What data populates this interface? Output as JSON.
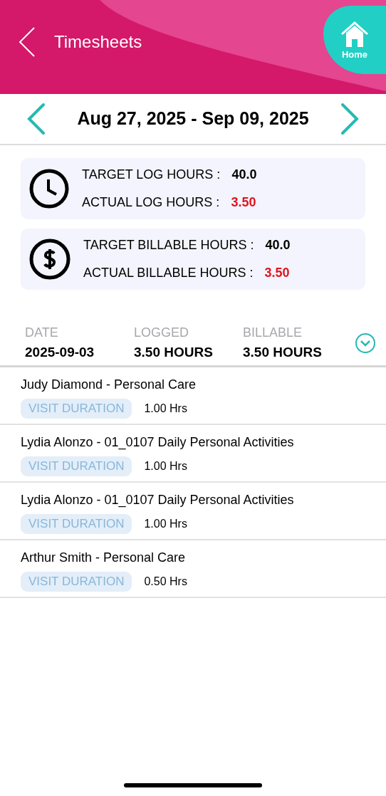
{
  "header": {
    "title": "Timesheets",
    "home_label": "Home"
  },
  "period": {
    "range": "Aug 27, 2025 - Sep 09, 2025"
  },
  "summary_cards": [
    {
      "kind": "clock",
      "rows": [
        {
          "label": "TARGET LOG HOURS :",
          "value": "40.0",
          "highlight": false
        },
        {
          "label": "ACTUAL LOG HOURS :",
          "value": "3.50",
          "highlight": true
        }
      ]
    },
    {
      "kind": "dollar",
      "rows": [
        {
          "label": "TARGET BILLABLE HOURS :",
          "value": "40.0",
          "highlight": false
        },
        {
          "label": "ACTUAL BILLABLE HOURS :",
          "value": "3.50",
          "highlight": true
        }
      ]
    }
  ],
  "day": {
    "columns": [
      {
        "label": "DATE",
        "value": "2025-09-03"
      },
      {
        "label": "LOGGED",
        "value": "3.50 HOURS"
      },
      {
        "label": "BILLABLE",
        "value": "3.50 HOURS"
      }
    ],
    "expanded": true
  },
  "visits": [
    {
      "title": "Judy Diamond - Personal Care",
      "tag": "VISIT DURATION",
      "duration": "1.00 Hrs"
    },
    {
      "title": "Lydia Alonzo - 01_0107 Daily Personal Activities",
      "tag": "VISIT DURATION",
      "duration": "1.00 Hrs"
    },
    {
      "title": "Lydia Alonzo - 01_0107 Daily Personal Activities",
      "tag": "VISIT DURATION",
      "duration": "1.00 Hrs"
    },
    {
      "title": "Arthur Smith - Personal Care",
      "tag": "VISIT DURATION",
      "duration": "0.50 Hrs"
    }
  ]
}
